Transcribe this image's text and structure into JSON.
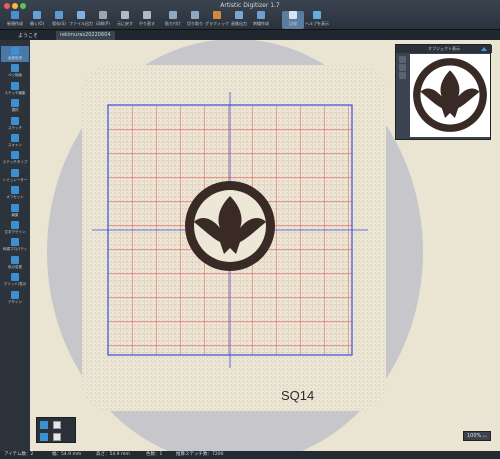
{
  "window": {
    "title": "Artistic Digitizer 1.7"
  },
  "toolbar": [
    {
      "label": "新規作成",
      "icon": "new-file-icon",
      "color": "#4a8fd4"
    },
    {
      "label": "開く(O)",
      "icon": "open-folder-icon",
      "color": "#6aa0d8"
    },
    {
      "label": "保存(S)",
      "icon": "save-icon",
      "color": "#5b9bd5"
    },
    {
      "label": "ファイル出力",
      "icon": "export-icon",
      "color": "#7fb0e0"
    },
    {
      "label": "印刷(P)",
      "icon": "print-icon",
      "color": "#9aa6b2"
    },
    {
      "label": "元に戻す",
      "icon": "undo-icon",
      "color": "#b0bac4"
    },
    {
      "label": "やり直す",
      "icon": "redo-icon",
      "color": "#b0bac4"
    },
    {
      "label": "貼り付け",
      "icon": "paste-icon",
      "color": "#8fa8c0"
    },
    {
      "label": "切り取り",
      "icon": "cut-icon",
      "color": "#8fa8c0"
    },
    {
      "label": "グラフィック",
      "icon": "graphic-icon",
      "color": "#d08a3c"
    },
    {
      "label": "画像出力",
      "icon": "image-export-icon",
      "color": "#7aa6d2"
    },
    {
      "label": "刺繍作成",
      "icon": "stitch-create-icon",
      "color": "#6f9fcf"
    },
    {
      "label": "記録",
      "icon": "record-icon",
      "color": "#d8e4f0"
    },
    {
      "label": "ヘルプを表示",
      "icon": "help-icon",
      "color": "#5fb0e0"
    }
  ],
  "tabs": [
    {
      "label": "ようこそ",
      "selected": false
    },
    {
      "label": "rekimuras20220604",
      "selected": true
    }
  ],
  "sidebar": [
    {
      "label": "画像取得",
      "icon": "image-import-icon",
      "selected": true
    },
    {
      "label": "ペン描画",
      "icon": "pen-icon",
      "selected": false
    },
    {
      "label": "ステッチ編集",
      "icon": "stitch-edit-icon",
      "selected": false
    },
    {
      "label": "選択",
      "icon": "select-icon",
      "selected": false
    },
    {
      "label": "ステッチ",
      "icon": "stitch-icon",
      "selected": false
    },
    {
      "label": "スキャン",
      "icon": "scan-icon",
      "selected": false
    },
    {
      "label": "ステッチタイプ",
      "icon": "stitch-type-icon",
      "selected": false
    },
    {
      "label": "シミュレーター",
      "icon": "simulator-icon",
      "selected": false
    },
    {
      "label": "オフセット",
      "icon": "offset-icon",
      "selected": false
    },
    {
      "label": "編集",
      "icon": "edit-icon",
      "selected": false
    },
    {
      "label": "文字デザイン",
      "icon": "text-design-icon",
      "selected": false
    },
    {
      "label": "刺繍プロパティ",
      "icon": "properties-icon",
      "selected": false
    },
    {
      "label": "色の変更",
      "icon": "color-change-icon",
      "selected": false
    },
    {
      "label": "グリッド/表示",
      "icon": "grid-icon",
      "selected": false
    },
    {
      "label": "デザイン",
      "icon": "design-icon",
      "selected": false
    }
  ],
  "object_panel": {
    "title": "オブジェクト表示"
  },
  "design_label": "SQ14",
  "zoom": {
    "value": "100%"
  },
  "status": {
    "items_label": "アイテム数：2",
    "width_label": "幅：54.9 mm",
    "height_label": "高さ：54.9 mm",
    "colors_label": "色数：1",
    "stitches_label": "推算ステッチ数：7200"
  },
  "colors": {
    "thread": "#3a2a25",
    "grid_major": "#e0504a",
    "hoop_area": "#3a50e0",
    "hoop_ring": "#c8c8cc"
  }
}
